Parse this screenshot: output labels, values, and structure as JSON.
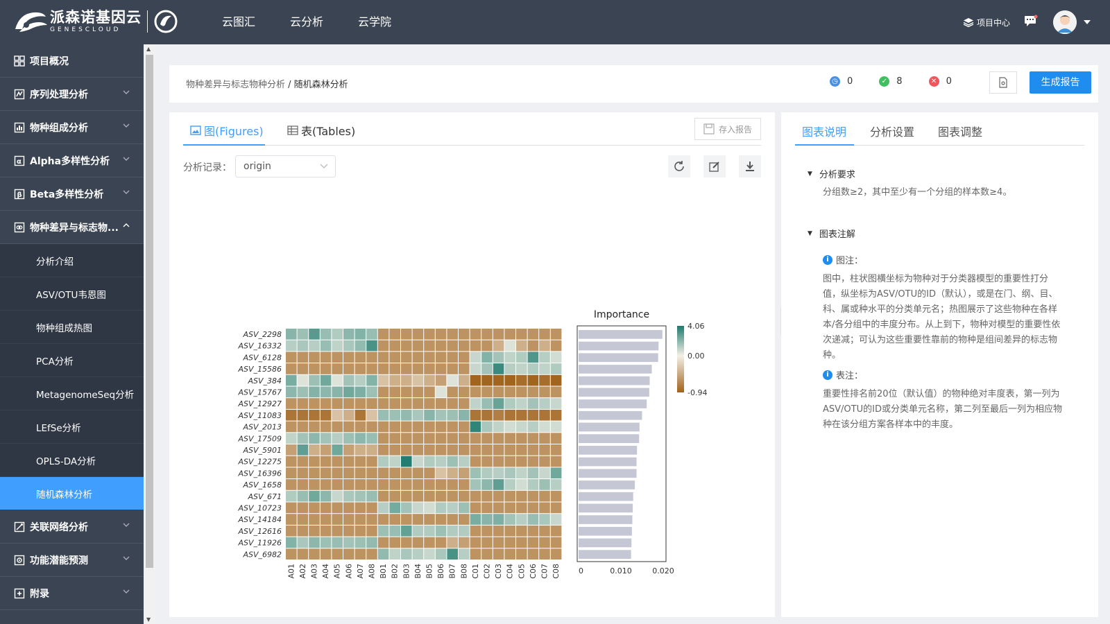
{
  "brand": {
    "name_cn": "派森诺基因云",
    "name_en": "GENESCLOUD"
  },
  "nav": [
    "云图汇",
    "云分析",
    "云学院"
  ],
  "topright": {
    "project_center": "项目中心"
  },
  "sidebar": {
    "items": [
      {
        "label": "项目概况",
        "icon": "grid-icon",
        "expandable": false
      },
      {
        "label": "序列处理分析",
        "icon": "sequence-icon",
        "expandable": true
      },
      {
        "label": "物种组成分析",
        "icon": "composition-icon",
        "expandable": true
      },
      {
        "label": "Alpha多样性分析",
        "icon": "alpha-icon",
        "expandable": true
      },
      {
        "label": "Beta多样性分析",
        "icon": "beta-icon",
        "expandable": true
      },
      {
        "label": "物种差异与标志物...",
        "icon": "diff-icon",
        "expandable": true,
        "expanded": true
      }
    ],
    "subitems": [
      "分析介绍",
      "ASV/OTU韦恩图",
      "物种组成热图",
      "PCA分析",
      "MetagenomeSeq分析",
      "LEfSe分析",
      "OPLS-DA分析",
      "随机森林分析"
    ],
    "active_sub": "随机森林分析",
    "bottom_items": [
      {
        "label": "关联网络分析",
        "icon": "network-icon"
      },
      {
        "label": "功能潜能预测",
        "icon": "function-icon"
      },
      {
        "label": "附录",
        "icon": "appendix-icon"
      }
    ]
  },
  "breadcrumb": {
    "parent": "物种差异与标志物种分析",
    "sep": " / ",
    "current": "随机森林分析"
  },
  "status": {
    "running": "0",
    "success": "8",
    "failed": "0"
  },
  "buttons": {
    "generate": "生成报告",
    "save_report": "存入报告"
  },
  "tabs": {
    "figures": "图(Figures)",
    "tables": "表(Tables)"
  },
  "record": {
    "label": "分析记录：",
    "value": "origin"
  },
  "right_tabs": [
    "图表说明",
    "分析设置",
    "图表调整"
  ],
  "panel": {
    "req_title": "分析要求",
    "req_text": "分组数≥2，其中至少有一个分组的样本数≥4。",
    "note_title": "图表注解",
    "fig_label": "图注：",
    "fig_text": "图中，柱状图横坐标为物种对于分类器模型的重要性打分值，纵坐标为ASV/OTU的ID（默认），或是在门、纲、目、科、属或种水平的分类单元名；热图展示了这些物种在各样本/各分组中的丰度分布。从上到下，物种对模型的重要性依次递减；可认为这些重要性靠前的物种是组间差异的标志物种。",
    "tab_label": "表注：",
    "tab_text": "重要性排名前20位（默认值）的物种绝对丰度表，第一列为ASV/OTU的ID或分类单元名称，第二列至最后一列为相应物种在该分组方案各样本中的丰度。"
  },
  "chart_data": {
    "type": "heatmap",
    "title": "Importance",
    "rows": [
      "ASV_2298",
      "ASV_16332",
      "ASV_6128",
      "ASV_15586",
      "ASV_384",
      "ASV_15767",
      "ASV_12927",
      "ASV_11083",
      "ASV_2013",
      "ASV_17509",
      "ASV_5901",
      "ASV_12275",
      "ASV_16396",
      "ASV_1658",
      "ASV_671",
      "ASV_10723",
      "ASV_14184",
      "ASV_12616",
      "ASV_11926",
      "ASV_6982"
    ],
    "columns": [
      "A01",
      "A02",
      "A03",
      "A04",
      "A05",
      "A06",
      "A07",
      "A08",
      "B01",
      "B02",
      "B03",
      "B04",
      "B05",
      "B06",
      "B07",
      "B08",
      "C01",
      "C02",
      "C03",
      "C04",
      "C05",
      "C06",
      "C07",
      "C08"
    ],
    "color_scale": {
      "max": 4.06,
      "mid": 0.0,
      "min": -0.94,
      "labels": [
        "4.06",
        "0.00",
        "-0.94"
      ],
      "colors": [
        "#1e7a6e",
        "#f4f0e6",
        "#a0621c"
      ]
    },
    "values": [
      [
        1.3,
        0.9,
        2.4,
        1.0,
        0.6,
        1.2,
        1.4,
        1.0,
        -0.4,
        -0.4,
        -0.4,
        -0.4,
        -0.4,
        -0.4,
        -0.4,
        -0.4,
        -0.4,
        -0.4,
        -0.4,
        -0.4,
        -0.4,
        -0.4,
        -0.4,
        -0.4
      ],
      [
        0.5,
        0.7,
        0.5,
        1.0,
        0.4,
        0.7,
        1.1,
        2.8,
        -0.4,
        -0.4,
        -0.4,
        -0.4,
        -0.4,
        -0.4,
        -0.4,
        -0.4,
        -0.4,
        -0.4,
        -0.2,
        0.1,
        -0.2,
        -0.4,
        -0.2,
        -0.4
      ],
      [
        -0.4,
        -0.4,
        -0.4,
        -0.4,
        -0.4,
        -0.4,
        -0.4,
        -0.4,
        -0.4,
        -0.4,
        -0.4,
        -0.4,
        -0.4,
        -0.4,
        -0.4,
        -0.4,
        0.3,
        1.4,
        0.8,
        0.4,
        0.6,
        2.6,
        0.5,
        0.2
      ],
      [
        -0.4,
        -0.4,
        -0.4,
        -0.4,
        -0.4,
        -0.4,
        -0.4,
        -0.4,
        -0.4,
        -0.4,
        -0.4,
        -0.4,
        -0.4,
        -0.4,
        -0.4,
        -0.4,
        0.3,
        0.8,
        3.2,
        0.5,
        0.4,
        0.6,
        0.4,
        0.6
      ],
      [
        1.6,
        0.1,
        0.9,
        1.8,
        0.1,
        0.8,
        0.5,
        1.4,
        -0.1,
        -0.2,
        -0.2,
        -0.1,
        -0.2,
        -0.3,
        0.1,
        -0.2,
        -0.9,
        -0.9,
        -0.9,
        -0.9,
        -0.8,
        -0.9,
        -0.8,
        -0.9
      ],
      [
        1.2,
        0.9,
        1.4,
        1.2,
        1.3,
        1.8,
        1.5,
        0.9,
        -0.4,
        -0.4,
        -0.4,
        -0.4,
        -0.4,
        0.1,
        -0.4,
        -0.4,
        -0.4,
        -0.4,
        -0.4,
        -0.4,
        -0.4,
        -0.4,
        -0.4,
        -0.4
      ],
      [
        -0.4,
        -0.4,
        -0.4,
        -0.4,
        -0.4,
        -0.4,
        -0.4,
        -0.4,
        -0.4,
        -0.4,
        -0.4,
        -0.4,
        -0.4,
        -0.4,
        -0.4,
        -0.4,
        0.4,
        1.0,
        2.0,
        0.6,
        0.4,
        0.8,
        0.5,
        0.3
      ],
      [
        -0.7,
        -0.7,
        -0.7,
        -0.7,
        -0.1,
        -0.2,
        -0.7,
        -0.1,
        1.0,
        0.9,
        1.1,
        0.7,
        1.3,
        0.8,
        0.9,
        1.3,
        -0.7,
        -0.7,
        -0.6,
        -0.7,
        -0.7,
        -0.7,
        -0.7,
        -0.7
      ],
      [
        -0.4,
        -0.4,
        -0.4,
        -0.4,
        -0.4,
        -0.4,
        -0.4,
        -0.4,
        -0.4,
        -0.4,
        -0.4,
        -0.4,
        -0.4,
        -0.4,
        -0.4,
        -0.4,
        3.5,
        0.7,
        0.4,
        0.2,
        0.3,
        0.5,
        0.2,
        0.2
      ],
      [
        0.4,
        0.8,
        1.2,
        0.8,
        0.5,
        0.9,
        1.2,
        1.0,
        -0.4,
        -0.4,
        -0.4,
        -0.4,
        -0.4,
        -0.4,
        -0.4,
        -0.4,
        -0.4,
        -0.4,
        -0.4,
        -0.4,
        -0.4,
        -0.4,
        -0.4,
        -0.4
      ],
      [
        -0.3,
        2.2,
        -0.2,
        -0.3,
        1.8,
        -0.3,
        -0.2,
        -0.2,
        -0.4,
        -0.4,
        -0.4,
        -0.4,
        -0.4,
        -0.4,
        -0.4,
        -0.4,
        -0.4,
        -0.4,
        -0.4,
        -0.4,
        -0.4,
        -0.4,
        -0.4,
        -0.4
      ],
      [
        -0.4,
        -0.4,
        -0.4,
        -0.4,
        -0.4,
        -0.4,
        -0.4,
        -0.4,
        0.6,
        0.4,
        3.9,
        0.3,
        0.6,
        0.5,
        0.9,
        0.5,
        -0.4,
        -0.4,
        -0.4,
        -0.4,
        -0.4,
        -0.4,
        -0.4,
        -0.4
      ],
      [
        -0.4,
        -0.4,
        -0.4,
        -0.4,
        -0.4,
        -0.4,
        -0.4,
        -0.4,
        -0.4,
        -0.4,
        -0.4,
        -0.4,
        -0.4,
        -0.1,
        -0.2,
        -0.3,
        0.9,
        0.6,
        0.5,
        0.7,
        0.4,
        0.8,
        0.3,
        1.8
      ],
      [
        -0.4,
        -0.4,
        -0.4,
        -0.4,
        -0.4,
        -0.4,
        -0.4,
        -0.4,
        -0.4,
        -0.4,
        -0.4,
        -0.4,
        -0.4,
        -0.4,
        -0.4,
        -0.4,
        0.8,
        1.2,
        2.2,
        0.5,
        0.2,
        0.6,
        0.9,
        0.5
      ],
      [
        0.6,
        1.0,
        1.8,
        1.2,
        0.3,
        0.7,
        0.8,
        1.0,
        -0.4,
        -0.4,
        -0.4,
        -0.4,
        -0.4,
        -0.4,
        -0.4,
        -0.4,
        -0.4,
        -0.4,
        -0.4,
        -0.4,
        -0.4,
        -0.4,
        -0.4,
        -0.4
      ],
      [
        -0.4,
        -0.4,
        -0.4,
        -0.4,
        -0.4,
        -0.4,
        -0.4,
        -0.4,
        0.5,
        1.7,
        0.8,
        0.3,
        0.2,
        0.6,
        0.5,
        0.9,
        -0.4,
        -0.4,
        -0.4,
        -0.4,
        -0.4,
        -0.4,
        -0.4,
        -0.4
      ],
      [
        -0.4,
        -0.4,
        -0.4,
        -0.4,
        -0.4,
        -0.4,
        -0.4,
        -0.4,
        -0.4,
        -0.4,
        -0.4,
        -0.4,
        -0.4,
        -0.4,
        -0.4,
        -0.4,
        1.6,
        1.3,
        1.5,
        0.8,
        0.5,
        1.0,
        0.7,
        0.3
      ],
      [
        -0.4,
        -0.4,
        -0.4,
        -0.4,
        -0.4,
        -0.4,
        -0.4,
        -0.4,
        0.9,
        1.0,
        2.1,
        0.6,
        0.6,
        0.9,
        0.6,
        0.6,
        -0.4,
        -0.4,
        -0.4,
        -0.4,
        -0.4,
        -0.4,
        -0.4,
        -0.4
      ],
      [
        1.4,
        0.7,
        1.2,
        0.9,
        1.0,
        0.8,
        0.9,
        1.1,
        -0.4,
        -0.4,
        -0.4,
        -0.4,
        -0.4,
        -0.4,
        -0.2,
        -0.3,
        -0.4,
        -0.4,
        -0.4,
        -0.4,
        -0.4,
        -0.4,
        -0.4,
        -0.4
      ],
      [
        -0.4,
        -0.4,
        -0.4,
        -0.4,
        -0.4,
        -0.4,
        -0.4,
        -0.4,
        1.1,
        0.4,
        0.7,
        0.5,
        0.3,
        0.7,
        2.8,
        0.5,
        -0.4,
        -0.4,
        -0.4,
        -0.4,
        -0.4,
        -0.4,
        -0.4,
        -0.4
      ]
    ],
    "importance": [
      0.0198,
      0.0189,
      0.0188,
      0.0173,
      0.0168,
      0.0167,
      0.0161,
      0.015,
      0.0144,
      0.0143,
      0.0138,
      0.0137,
      0.0137,
      0.0133,
      0.0129,
      0.0128,
      0.0127,
      0.0126,
      0.0125,
      0.0124
    ],
    "importance_ticks": [
      "0",
      "0.010",
      "0.020"
    ],
    "importance_xlim": [
      0,
      0.02
    ]
  }
}
